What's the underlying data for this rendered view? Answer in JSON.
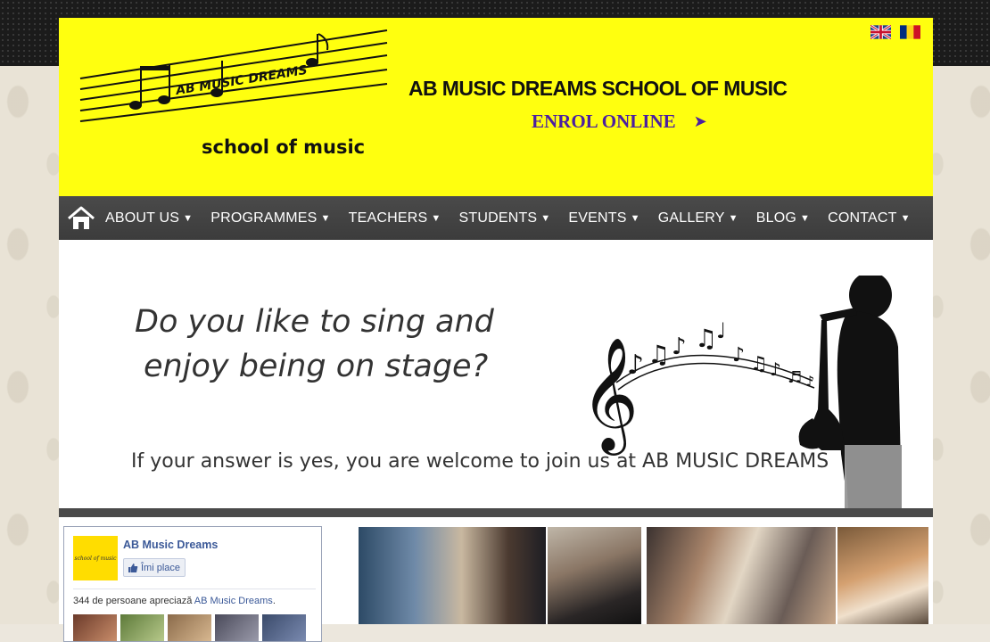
{
  "header": {
    "site_title": "AB MUSIC DREAMS SCHOOL OF MUSIC",
    "enrol_label": "ENROL ONLINE",
    "enrol_arrow": "➤",
    "logo_words": {
      "top": "AB MUSIC DREAMS",
      "bottom": "school of music"
    },
    "languages": [
      "English",
      "Română"
    ]
  },
  "nav": {
    "items": [
      {
        "label": "ABOUT US"
      },
      {
        "label": "PROGRAMMES"
      },
      {
        "label": "TEACHERS"
      },
      {
        "label": "STUDENTS"
      },
      {
        "label": "EVENTS"
      },
      {
        "label": "GALLERY"
      },
      {
        "label": "BLOG"
      },
      {
        "label": "CONTACT"
      }
    ],
    "caret": "▼"
  },
  "hero": {
    "line1": "Do you like to sing and",
    "line2": "enjoy being on stage?",
    "invite": "If your answer is yes, you are welcome to join us at  AB MUSIC DREAMS"
  },
  "facebook": {
    "page_name": "AB Music Dreams",
    "like_label": "Îmi place",
    "count_text": "344 de persoane apreciază",
    "count_link": "AB Music Dreams",
    "count_suffix": "."
  },
  "colors": {
    "header_bg": "#ffff0f",
    "nav_bg": "#434343",
    "enrol": "#4b1fa0",
    "fb_blue": "#3b5998"
  }
}
